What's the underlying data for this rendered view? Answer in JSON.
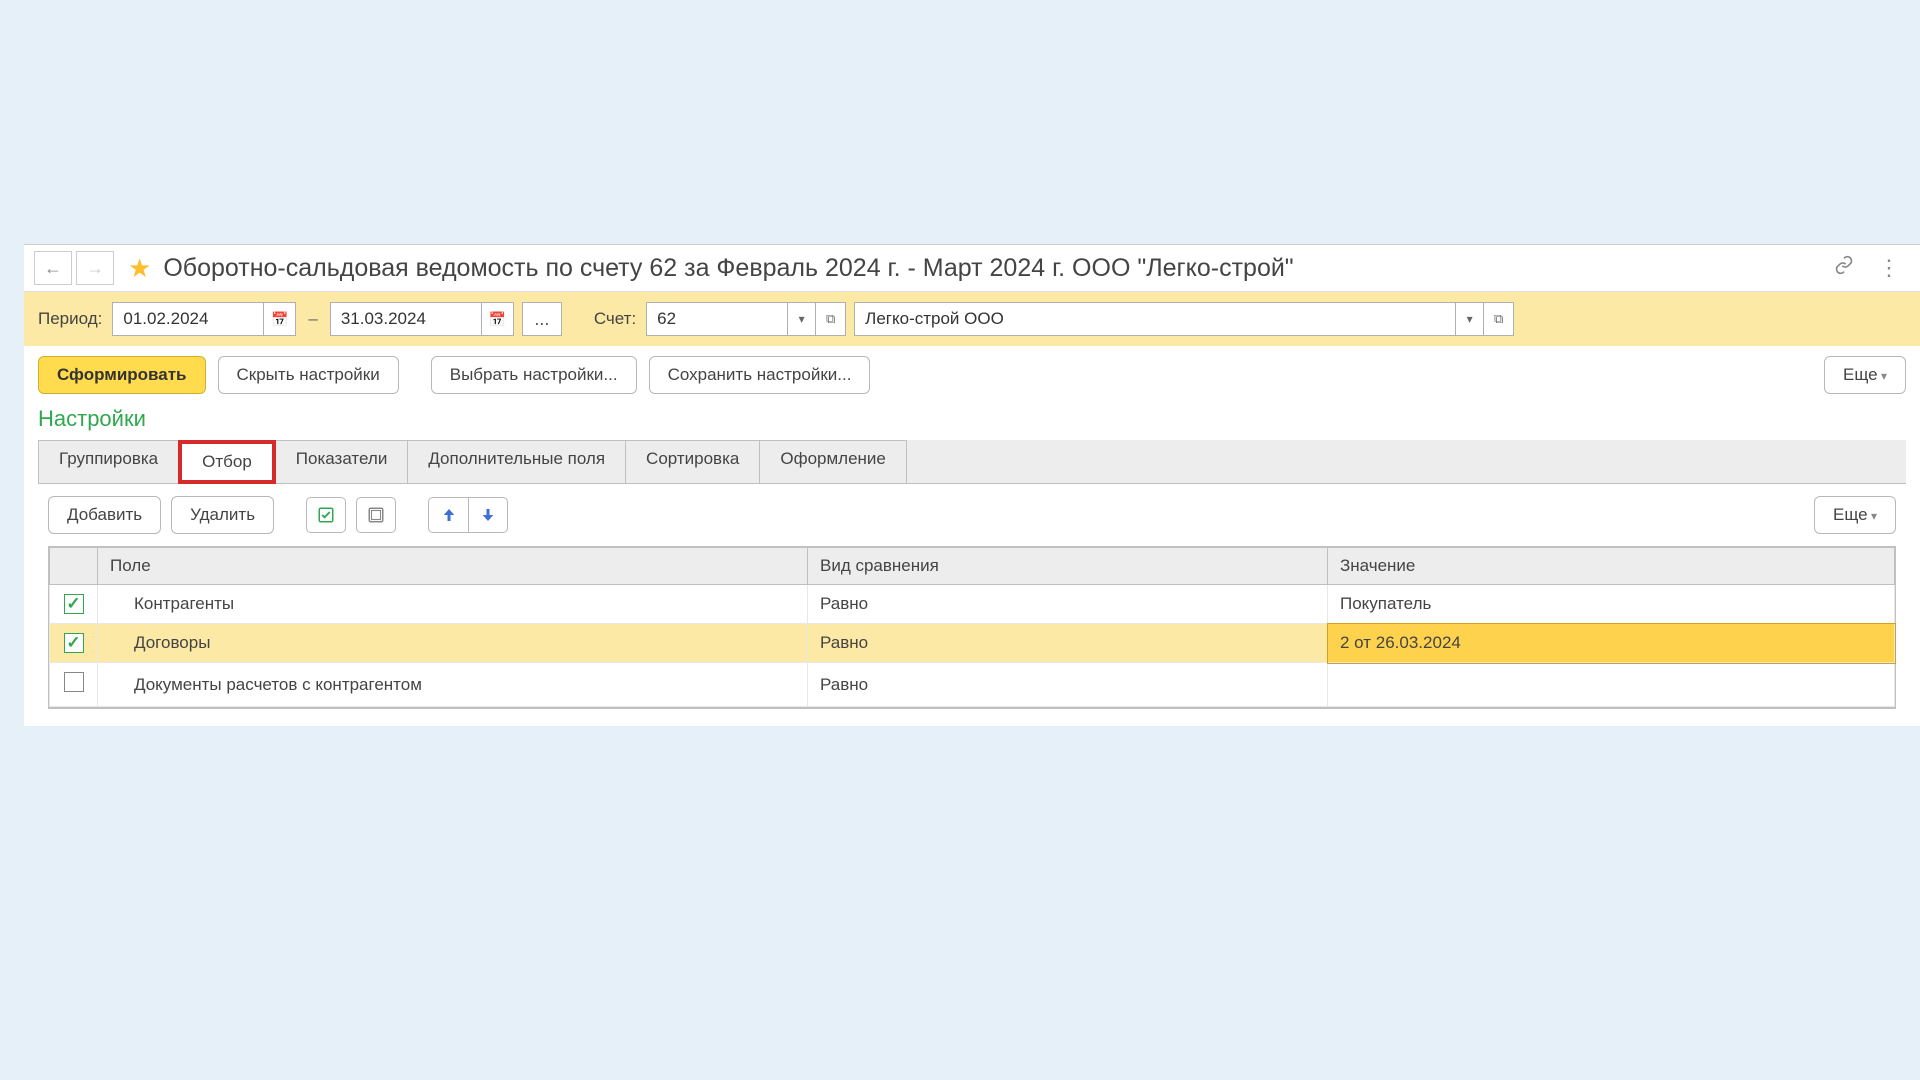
{
  "header": {
    "title": "Оборотно-сальдовая ведомость по счету 62 за Февраль 2024 г. - Март 2024 г. ООО \"Легко-строй\""
  },
  "period": {
    "label": "Период:",
    "from": "01.02.2024",
    "to": "31.03.2024",
    "dash": "–",
    "ellipsis": "...",
    "account_label": "Счет:",
    "account": "62",
    "org": "Легко-строй ООО"
  },
  "actions": {
    "generate": "Сформировать",
    "hide_settings": "Скрыть настройки",
    "choose_settings": "Выбрать настройки...",
    "save_settings": "Сохранить настройки...",
    "more": "Еще"
  },
  "settings_label": "Настройки",
  "tabs": {
    "grouping": "Группировка",
    "filter": "Отбор",
    "indicators": "Показатели",
    "extra_fields": "Дополнительные поля",
    "sorting": "Сортировка",
    "formatting": "Оформление"
  },
  "filter_toolbar": {
    "add": "Добавить",
    "delete": "Удалить",
    "more": "Еще"
  },
  "filter_table": {
    "headers": {
      "field": "Поле",
      "comparison": "Вид сравнения",
      "value": "Значение"
    },
    "rows": [
      {
        "checked": true,
        "field": "Контрагенты",
        "comparison": "Равно",
        "value": "Покупатель"
      },
      {
        "checked": true,
        "field": "Договоры",
        "comparison": "Равно",
        "value": "2 от 26.03.2024"
      },
      {
        "checked": false,
        "field": "Документы расчетов с контрагентом",
        "comparison": "Равно",
        "value": ""
      }
    ]
  }
}
